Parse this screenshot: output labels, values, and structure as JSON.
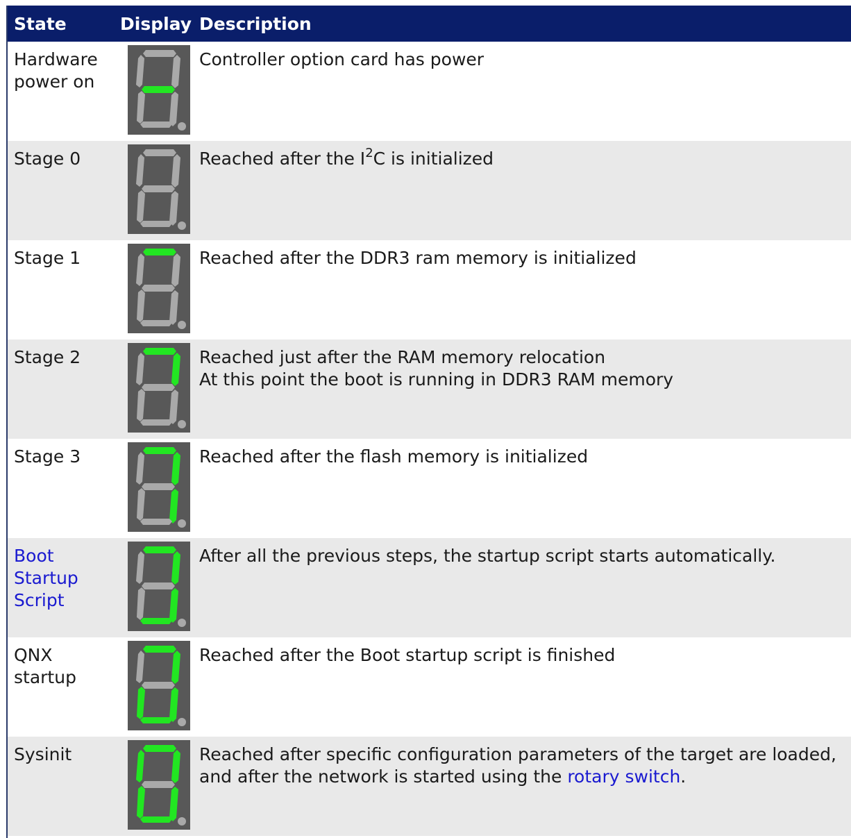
{
  "header": {
    "state": "State",
    "display": "Display",
    "description": "Description"
  },
  "rows": [
    {
      "state": "Hardware power on",
      "description": [
        "Controller option card has power"
      ],
      "segments_on": [
        "g"
      ]
    },
    {
      "state": "Stage 0",
      "description_parts": [
        "Reached after the I",
        "2",
        "C is initialized"
      ],
      "segments_on": []
    },
    {
      "state": "Stage 1",
      "description": [
        "Reached after the DDR3 ram memory is initialized"
      ],
      "segments_on": [
        "a"
      ]
    },
    {
      "state": "Stage 2",
      "description": [
        "Reached just after the RAM memory relocation",
        "At this point the boot is running in DDR3 RAM memory"
      ],
      "segments_on": [
        "a",
        "b"
      ]
    },
    {
      "state": "Stage 3",
      "description": [
        "Reached after the flash memory is initialized"
      ],
      "segments_on": [
        "a",
        "b",
        "c"
      ]
    },
    {
      "state": "Boot Startup Script",
      "state_is_link": true,
      "description": [
        "After all the previous steps, the startup script starts automatically."
      ],
      "segments_on": [
        "a",
        "b",
        "c",
        "d"
      ]
    },
    {
      "state": "QNX startup",
      "description": [
        "Reached after the Boot startup script is finished"
      ],
      "segments_on": [
        "a",
        "b",
        "c",
        "d",
        "e"
      ]
    },
    {
      "state": "Sysinit",
      "description_parts": [
        "Reached after specific configuration parameters of the target are loaded,",
        "and after the network is started using the ",
        "rotary switch",
        "."
      ],
      "segments_on": [
        "a",
        "b",
        "c",
        "d",
        "e",
        "f"
      ]
    }
  ],
  "colors": {
    "header_bg": "#0a1e6a",
    "segment_on": "#22e622",
    "segment_off": "#a9a9a9",
    "display_bg": "#585858",
    "link": "#1a1ad0"
  }
}
